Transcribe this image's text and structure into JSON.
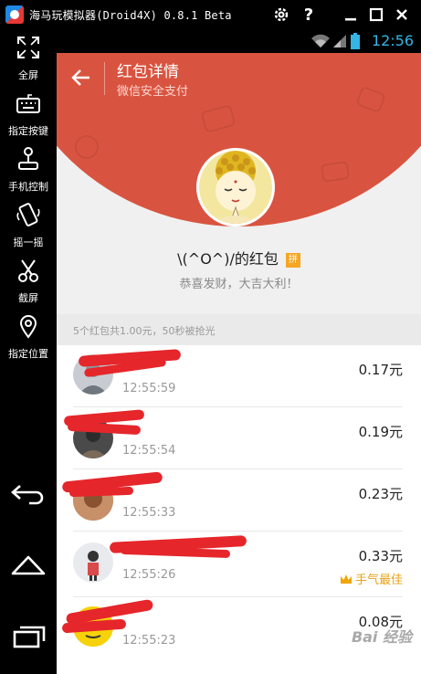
{
  "window": {
    "title": "海马玩模拟器(Droid4X) 0.8.1 Beta",
    "settings_icon": "gear-icon",
    "help_label": "?",
    "minimize_label": "—",
    "maximize_label": "☐",
    "close_label": "✕"
  },
  "toolbar": {
    "items": [
      {
        "label": "全屏",
        "icon": "fullscreen-icon"
      },
      {
        "label": "指定按键",
        "icon": "keyboard-icon"
      },
      {
        "label": "手机控制",
        "icon": "joystick-icon"
      },
      {
        "label": "摇一摇",
        "icon": "shake-icon"
      },
      {
        "label": "截屏",
        "icon": "scissors-icon"
      },
      {
        "label": "指定位置",
        "icon": "location-pin-icon"
      }
    ],
    "nav": [
      "back-icon",
      "home-icon",
      "recent-apps-icon"
    ]
  },
  "statusbar": {
    "time": "12:56"
  },
  "header": {
    "title": "红包详情",
    "subtitle": "微信安全支付"
  },
  "sender": {
    "name": "\\(^O^)/的红包",
    "badge": "拼",
    "blessing": "恭喜发财，大吉大利！"
  },
  "summary": "5个红包共1.00元，50秒被抢光",
  "records": [
    {
      "name": "",
      "time": "12:55:59",
      "amount": "0.17元",
      "best": ""
    },
    {
      "name": "",
      "time": "12:55:54",
      "amount": "0.19元",
      "best": ""
    },
    {
      "name": "",
      "time": "12:55:33",
      "amount": "0.23元",
      "best": ""
    },
    {
      "name": "",
      "time": "12:55:26",
      "amount": "0.33元",
      "best": "手气最佳"
    },
    {
      "name": "",
      "time": "12:55:23",
      "amount": "0.08元",
      "best": ""
    }
  ],
  "watermark": "Bai 经验",
  "colors": {
    "header_red": "#d95440",
    "clock_blue": "#33b5e5",
    "best_gold": "#e8a215"
  }
}
